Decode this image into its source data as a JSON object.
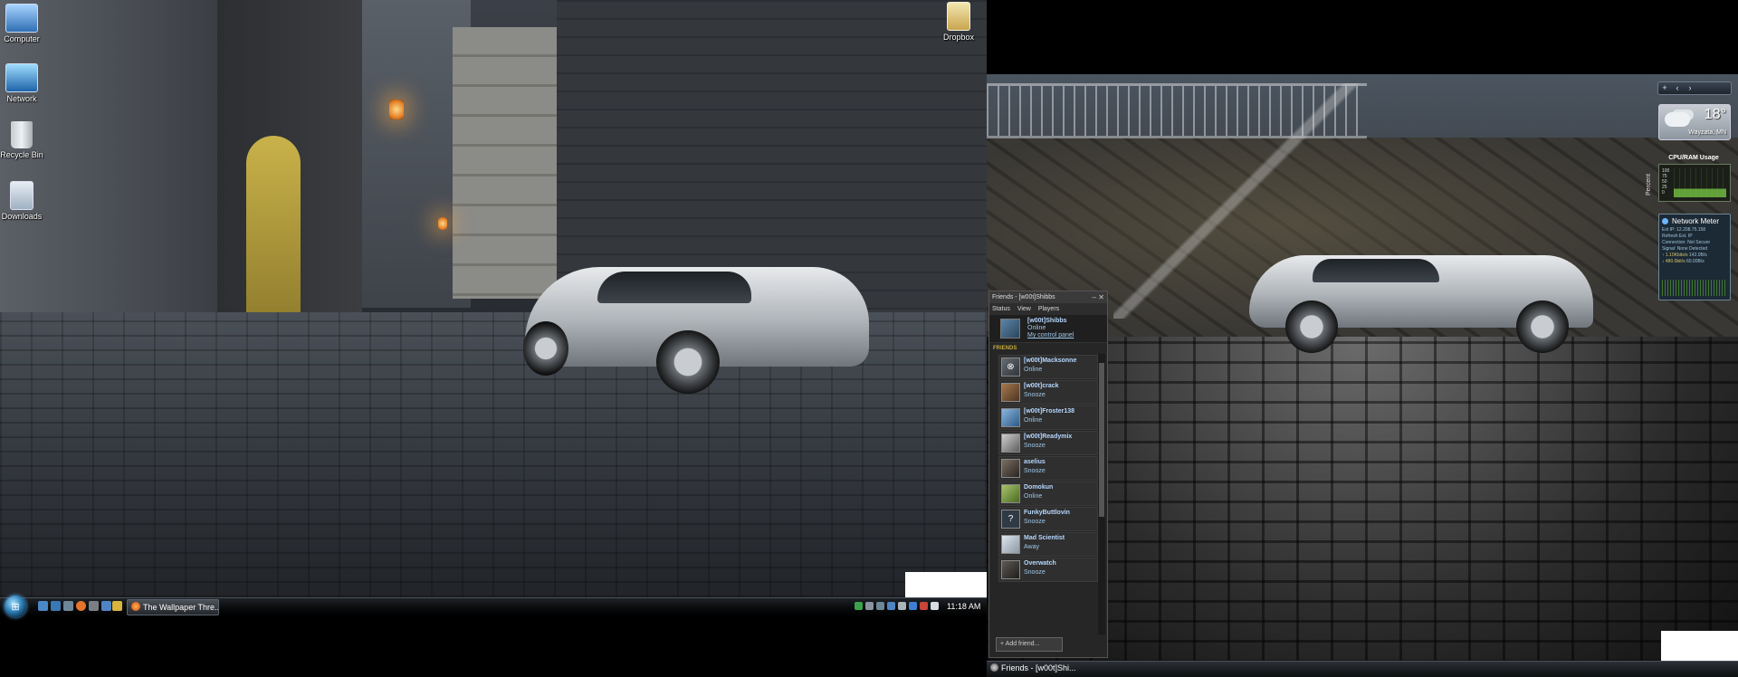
{
  "desktop_icons": [
    {
      "label": "Computer",
      "icon": "computer-icon"
    },
    {
      "label": "Network",
      "icon": "network-icon"
    },
    {
      "label": "Recycle Bin",
      "icon": "recycle-bin-icon"
    },
    {
      "label": "Downloads",
      "icon": "downloads-folder-icon"
    },
    {
      "label": "Dropbox",
      "icon": "dropbox-folder-icon"
    }
  ],
  "taskbar_left": {
    "start_icon": "windows-start-orb-icon",
    "window_button_label": "The Wallpaper Thre...",
    "clock": "11:18 AM"
  },
  "gadgets": {
    "weather": {
      "temperature": "18°",
      "location": "Wayzata, MN"
    },
    "cpu": {
      "title": "CPU/RAM Usage",
      "axis_label": "Percent",
      "ticks": [
        "100",
        "75",
        "50",
        "25",
        "0"
      ]
    },
    "network": {
      "title": "Network Meter",
      "lines": [
        "Ext IP: 12.208.75.158",
        "Refresh Ext. IP",
        "Connection: Not Secure",
        "Signal: None Detected"
      ],
      "up": "1.10Kbits/s",
      "up_total": "142.0B/s",
      "down": "480.0bit/s",
      "down_total": "60.00B/s"
    }
  },
  "friends_window": {
    "title": "Friends - [w00t]Shibbs",
    "menu": [
      "Status",
      "View",
      "Players"
    ],
    "self": {
      "name": "[w00t]Shibbs",
      "status": "Online",
      "link": "My control panel"
    },
    "section_label": "FRIENDS",
    "friends": [
      {
        "name": "[w00t]Macksonne",
        "status": "Online"
      },
      {
        "name": "[w00t]crack",
        "status": "Snooze"
      },
      {
        "name": "[w00t]Froster138",
        "status": "Online"
      },
      {
        "name": "[w00t]Readymix",
        "status": "Snooze"
      },
      {
        "name": "aselius",
        "status": "Snooze"
      },
      {
        "name": "Domokun",
        "status": "Online"
      },
      {
        "name": "FunkyButtlovin",
        "status": "Snooze"
      },
      {
        "name": "Mad Scientist",
        "status": "Away"
      },
      {
        "name": "Overwatch",
        "status": "Snooze"
      }
    ],
    "add_friend": "+ Add friend..."
  },
  "taskbar_right": {
    "window_button_label": "Friends - [w00t]Shi..."
  }
}
